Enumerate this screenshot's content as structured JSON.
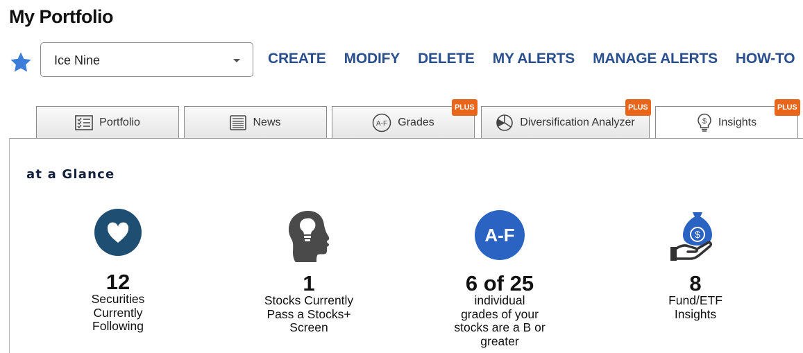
{
  "page": {
    "title": "My Portfolio"
  },
  "portfolio_select": {
    "value": "Ice Nine"
  },
  "actions": [
    "CREATE",
    "MODIFY",
    "DELETE",
    "MY ALERTS",
    "MANAGE ALERTS",
    "HOW-TO"
  ],
  "tabs": [
    {
      "label": "Portfolio",
      "icon": "checklist-icon",
      "plus": false
    },
    {
      "label": "News",
      "icon": "newspaper-icon",
      "plus": false
    },
    {
      "label": "Grades",
      "icon": "grades-icon",
      "plus": true
    },
    {
      "label": "Diversification Analyzer",
      "icon": "pie-chart-icon",
      "plus": true
    },
    {
      "label": "Insights",
      "icon": "dollar-lightbulb-icon",
      "plus": true
    }
  ],
  "plus_label": "PLUS",
  "section": {
    "title": "at a Glance"
  },
  "stats": [
    {
      "value": "12",
      "desc_lines": [
        "Securities",
        "Currently",
        "Following"
      ],
      "icon": "heart-circle-icon"
    },
    {
      "value": "1",
      "desc_lines": [
        "Stocks Currently",
        "Pass a Stocks+",
        "Screen"
      ],
      "icon": "head-lightbulb-icon"
    },
    {
      "value": "6 of 25",
      "desc_lines": [
        "individual",
        "grades of your",
        "stocks are a B or",
        "greater"
      ],
      "icon": "grades-circle-icon",
      "icon_text": "A-F"
    },
    {
      "value": "8",
      "desc_lines": [
        "Fund/ETF",
        "Insights"
      ],
      "icon": "money-bag-hand-icon"
    }
  ],
  "colors": {
    "action": "#2a4f8e",
    "star": "#3b7dd8",
    "plus_badge": "#e8651a",
    "heart_circle": "#1f4e73",
    "grades_circle": "#2b63c2"
  }
}
